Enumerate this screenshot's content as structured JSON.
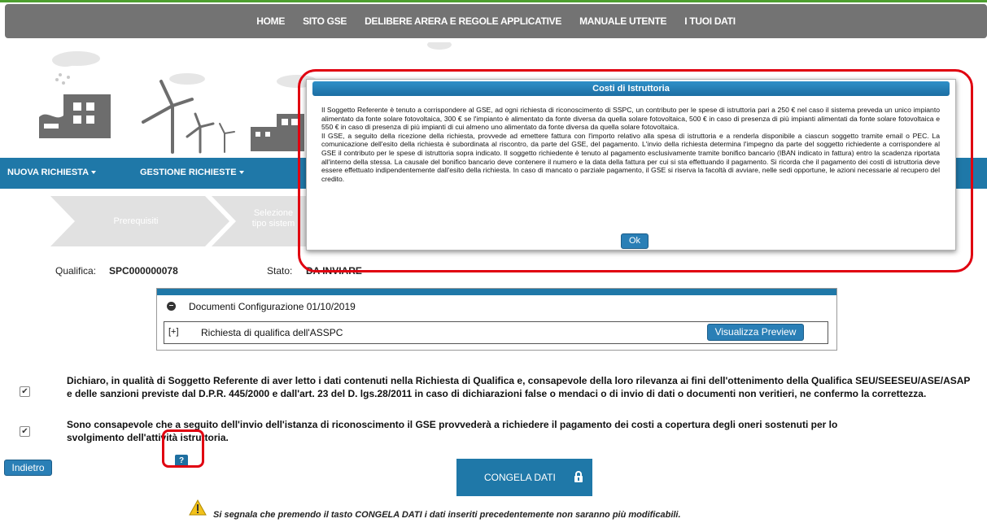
{
  "topnav": {
    "items": [
      "HOME",
      "SITO GSE",
      "DELIBERE ARERA E REGOLE APPLICATIVE",
      "MANUALE UTENTE",
      "I TUOI DATI"
    ]
  },
  "mainnav": {
    "nuova": "NUOVA RICHIESTA",
    "gestione": "GESTIONE RICHIESTE"
  },
  "steps": {
    "step1": "Prerequisiti",
    "step2_line1": "Selezione",
    "step2_line2": "tipo sistem"
  },
  "qualifica": {
    "label": "Qualifica:",
    "value": "SPC000000078",
    "stato_label": "Stato:",
    "stato_value": "DA INVIARE"
  },
  "documents": {
    "header": "Documenti Configurazione 01/10/2019",
    "expand": "[+]",
    "row_label": "Richiesta di qualifica dell'ASSPC",
    "preview_button": "Visualizza Preview"
  },
  "declarations": {
    "first": "Dichiaro, in qualità di Soggetto Referente di aver letto i dati contenuti nella Richiesta di Qualifica e, consapevole della loro rilevanza ai fini dell'ottenimento della Qualifica SEU/SEESEU/ASE/ASAP e delle sanzioni previste dal D.P.R. 445/2000 e dall'art. 23 del D. lgs.28/2011 in caso di dichiarazioni false o mendaci o di invio di dati o documenti non veritieri, ne confermo la correttezza.",
    "second": "Sono consapevole che a seguito dell'invio dell'istanza di riconoscimento il GSE provvederà a richiedere il pagamento dei costi a copertura degli oneri sostenuti per lo svolgimento dell'attività istruttoria.",
    "help": "?"
  },
  "buttons": {
    "back": "Indietro",
    "freeze": "CONGELA DATI"
  },
  "warning": "Si segnala che premendo il tasto CONGELA DATI i dati inseriti precedentemente non saranno più modificabili.",
  "modal": {
    "title": "Costi di Istruttoria",
    "p1": "Il Soggetto Referente è tenuto a corrispondere al GSE, ad ogni richiesta di riconoscimento di SSPC, un contributo per le spese di istruttoria pari a 250 € nel caso il sistema preveda un unico impianto alimentato da fonte solare fotovoltaica, 300 € se l'impianto è alimentato da fonte diversa da quella solare fotovoltaica, 500 € in caso di presenza di più impianti alimentati da fonte solare fotovoltaica e 550 € in caso di presenza di più impianti di cui almeno uno alimentato da fonte diversa da quella solare fotovoltaica.",
    "p2": "Il GSE, a seguito della ricezione della richiesta, provvede ad emettere fattura con l'importo relativo alla spesa di istruttoria e a renderla disponibile a ciascun soggetto tramite email o PEC. La comunicazione dell'esito della richiesta è subordinata al riscontro, da parte del GSE, del pagamento. L'invio della richiesta determina l'impegno da parte del soggetto richiedente a corrispondere al GSE il contributo per le spese di istruttoria sopra indicato. Il soggetto richiedente è tenuto al pagamento esclusivamente tramite bonifico bancario (IBAN indicato in fattura) entro la scadenza riportata all'interno della stessa. La causale del bonifico bancario deve contenere il numero e la data della fattura per cui si sta effettuando il pagamento. Si ricorda che il pagamento dei costi di istruttoria deve essere effettuato indipendentemente dall'esito della richiesta. In caso di mancato o parziale pagamento, il GSE si riserva la facoltà di avviare, nelle sedi opportune, le azioni necessarie al recupero del credito.",
    "ok": "Ok"
  },
  "colors": {
    "nav_gray": "#737373",
    "brand_blue": "#1f78a8",
    "highlight_red": "#e00010",
    "top_green": "#4d9f2f"
  }
}
